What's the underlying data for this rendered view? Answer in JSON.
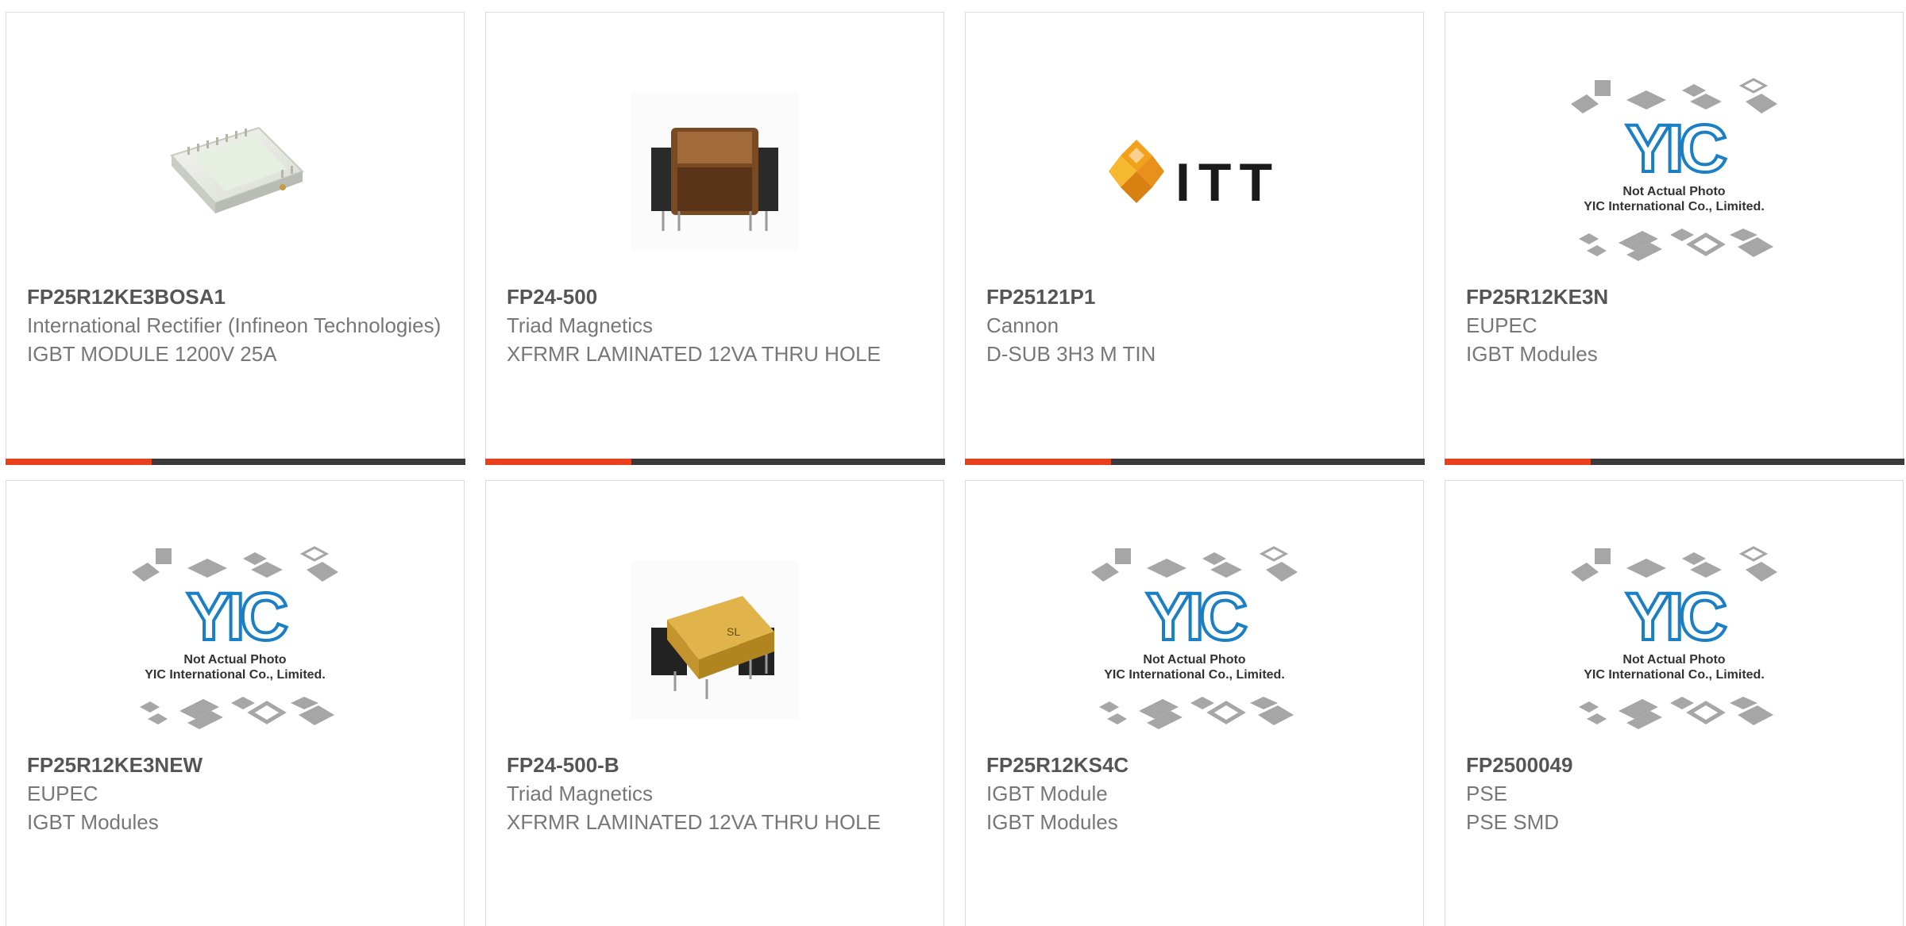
{
  "colors": {
    "accent": "#e8401c",
    "bar_dark": "#3a3a3a",
    "part_number": "#555555",
    "text_muted": "#777777",
    "yic_blue": "#1a7fc4"
  },
  "products": [
    {
      "part_number": "FP25R12KE3BOSA1",
      "manufacturer": "International Rectifier (Infineon Technologies)",
      "description": "IGBT MODULE 1200V 25A",
      "image": "igbt-module-photo"
    },
    {
      "part_number": "FP24-500",
      "manufacturer": "Triad Magnetics",
      "description": "XFRMR LAMINATED 12VA THRU HOLE",
      "image": "transformer-photo"
    },
    {
      "part_number": "FP25121P1",
      "manufacturer": "Cannon",
      "description": "D-SUB 3H3 M TIN",
      "image": "itt-logo",
      "logo_text": "ITT"
    },
    {
      "part_number": "FP25R12KE3N",
      "manufacturer": "EUPEC",
      "description": "IGBT Modules",
      "image": "yic-placeholder"
    },
    {
      "part_number": "FP25R12KE3NEW",
      "manufacturer": "EUPEC",
      "description": "IGBT Modules",
      "image": "yic-placeholder"
    },
    {
      "part_number": "FP24-500-B",
      "manufacturer": "Triad Magnetics",
      "description": "XFRMR LAMINATED 12VA THRU HOLE",
      "image": "transformer-photo"
    },
    {
      "part_number": "FP25R12KS4C",
      "manufacturer": "IGBT Module",
      "description": "IGBT Modules",
      "image": "yic-placeholder"
    },
    {
      "part_number": "FP2500049",
      "manufacturer": "PSE",
      "description": "PSE SMD",
      "image": "yic-placeholder"
    }
  ],
  "placeholder": {
    "line1": "Not Actual Photo",
    "line2": "YIC International Co., Limited.",
    "logo": "YIC"
  }
}
